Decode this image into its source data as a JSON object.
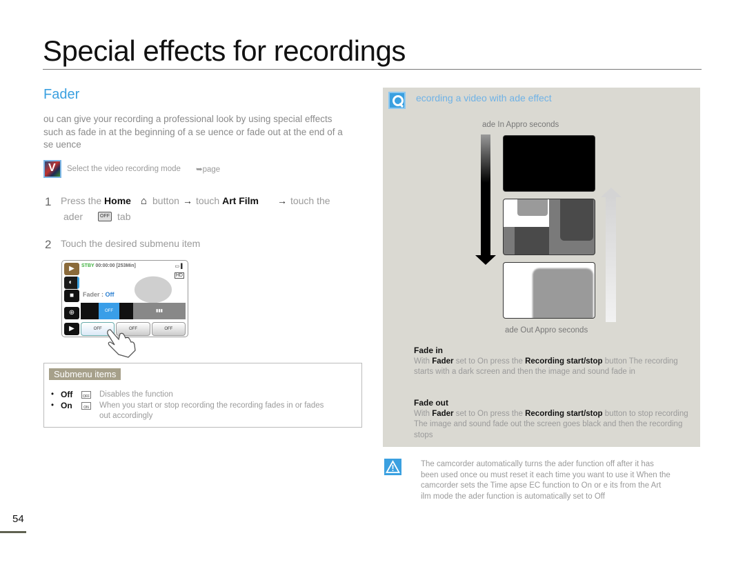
{
  "page": {
    "title": "Special effects for recordings",
    "number": "54"
  },
  "left": {
    "section_title": "Fader",
    "intro": "ou can give your recording a professional look by using special effects such as fade in at the beginning of a se uence or fade out at the end of a se uence",
    "prereq": {
      "icon": "video-mode-icon",
      "text": "Select the video recording mode",
      "page_ref": "➥page"
    },
    "steps": [
      {
        "num": "1",
        "pre": "Press the",
        "home": "Home",
        "home_icon": "⌂",
        "mid": "button",
        "arrow": "→",
        "touch": "touch",
        "art_film": "Art Film",
        "touch_the": "touch the",
        "line2_pre": "ader",
        "line2_post": "tab"
      },
      {
        "num": "2",
        "text": "Touch the desired submenu item"
      }
    ],
    "camera_screen": {
      "status": "STBY",
      "time": "00:00:00 [253Min]",
      "battery": "▭ ▌",
      "hd_badge": "HD",
      "fader_label": "Fader :",
      "fader_value": "Off",
      "bar_option_selected": "OFF",
      "bar_option_2": "▮▮▮",
      "tabs": [
        "OFF",
        "OFF",
        "OFF"
      ],
      "side_buttons": [
        "▶",
        "◐",
        "■",
        "⊕",
        "▶"
      ]
    },
    "submenu": {
      "label": "Submenu items",
      "items": [
        {
          "bullet": "•",
          "name": "Off",
          "icon_text": "OFF",
          "desc": "Disables the function"
        },
        {
          "bullet": "•",
          "name": "On",
          "icon_text": "ON",
          "desc": "When you start or stop recording  the recording fades in or fades out accordingly"
        }
      ]
    }
  },
  "right": {
    "heading": "ecording a video with  ade effect",
    "fade_in_caption": "ade In  Appro    seconds",
    "fade_out_caption": "ade Out  Appro      seconds",
    "fade_in": {
      "title": "Fade in",
      "p1": "With",
      "b1": "Fader",
      "p2": "set to On  press the",
      "b2": "Recording start/stop",
      "p3": "button  The recording starts with a dark screen  and then the image and sound fade in"
    },
    "fade_out": {
      "title": "Fade out",
      "p1": "With",
      "b1": "Fader",
      "p2": "set to On  press the",
      "b2": "Recording start/stop",
      "p3": "button to stop recording  The image and sound fade out  the screen goes black  and then the recording stops"
    }
  },
  "note": {
    "text": "The camcorder automatically turns the  ader function off after it has been used once   ou must reset it each time you want to use it When the camcorder sets the Time  apse  EC function to On or e its from the Art  ilm mode  the  ader function is automatically set to Off"
  },
  "colors": {
    "accent_blue": "#3aa0e0",
    "panel_bg": "#dad9d2",
    "submenu_label_bg": "#a6a08a"
  }
}
